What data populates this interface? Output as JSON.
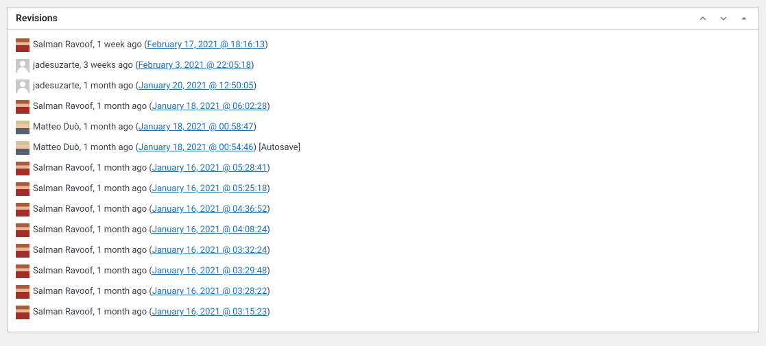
{
  "panel": {
    "title": "Revisions"
  },
  "revisions": [
    {
      "avatar": "salman",
      "author": "Salman Ravoof",
      "relative": "1 week ago",
      "timestamp": "February 17, 2021 @ 18:16:13",
      "suffix": ""
    },
    {
      "avatar": "jade",
      "author": "jadesuzarte",
      "relative": "3 weeks ago",
      "timestamp": "February 3, 2021 @ 22:05:18",
      "suffix": ""
    },
    {
      "avatar": "jade",
      "author": "jadesuzarte",
      "relative": "1 month ago",
      "timestamp": "January 20, 2021 @ 12:50:05",
      "suffix": ""
    },
    {
      "avatar": "salman",
      "author": "Salman Ravoof",
      "relative": "1 month ago",
      "timestamp": "January 18, 2021 @ 06:02:28",
      "suffix": ""
    },
    {
      "avatar": "matteo",
      "author": "Matteo Duò",
      "relative": "1 month ago",
      "timestamp": "January 18, 2021 @ 00:58:47",
      "suffix": ""
    },
    {
      "avatar": "matteo",
      "author": "Matteo Duò",
      "relative": "1 month ago",
      "timestamp": "January 18, 2021 @ 00:54:46",
      "suffix": " [Autosave]"
    },
    {
      "avatar": "salman",
      "author": "Salman Ravoof",
      "relative": "1 month ago",
      "timestamp": "January 16, 2021 @ 05:28:41",
      "suffix": ""
    },
    {
      "avatar": "salman",
      "author": "Salman Ravoof",
      "relative": "1 month ago",
      "timestamp": "January 16, 2021 @ 05:25:18",
      "suffix": ""
    },
    {
      "avatar": "salman",
      "author": "Salman Ravoof",
      "relative": "1 month ago",
      "timestamp": "January 16, 2021 @ 04:36:52",
      "suffix": ""
    },
    {
      "avatar": "salman",
      "author": "Salman Ravoof",
      "relative": "1 month ago",
      "timestamp": "January 16, 2021 @ 04:08:24",
      "suffix": ""
    },
    {
      "avatar": "salman",
      "author": "Salman Ravoof",
      "relative": "1 month ago",
      "timestamp": "January 16, 2021 @ 03:32:24",
      "suffix": ""
    },
    {
      "avatar": "salman",
      "author": "Salman Ravoof",
      "relative": "1 month ago",
      "timestamp": "January 16, 2021 @ 03:29:48",
      "suffix": ""
    },
    {
      "avatar": "salman",
      "author": "Salman Ravoof",
      "relative": "1 month ago",
      "timestamp": "January 16, 2021 @ 03:28:22",
      "suffix": ""
    },
    {
      "avatar": "salman",
      "author": "Salman Ravoof",
      "relative": "1 month ago",
      "timestamp": "January 16, 2021 @ 03:15:23",
      "suffix": ""
    }
  ]
}
